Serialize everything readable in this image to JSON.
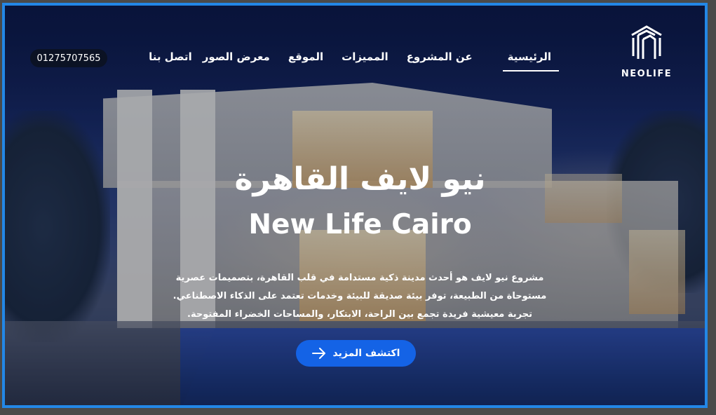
{
  "brand": {
    "name": "NEOLIFE"
  },
  "nav": {
    "items": [
      {
        "label": "الرئيسية",
        "active": true
      },
      {
        "label": "عن المشروع",
        "active": false
      },
      {
        "label": "المميزات",
        "active": false
      },
      {
        "label": "الموقع",
        "active": false
      },
      {
        "label": "معرض الصور",
        "active": false
      },
      {
        "label": "اتصل بنا",
        "active": false
      }
    ],
    "phone": "01275707565"
  },
  "hero": {
    "title_ar": "نيو لايف القاهرة",
    "title_en": "New Life Cairo",
    "description_lines": [
      "مشروع نيو لايف هو أحدث مدينة ذكية مستدامة في قلب القاهرة، بتصميمات عصرية",
      "مستوحاة من الطبيعة، توفر بيئة صديقة للبيئة وخدمات تعتمد على الذكاء الاصطناعي.",
      "تجربة معيشية فريدة تجمع بين الراحة، الابتكار، والمساحات الخضراء المفتوحة."
    ],
    "cta_label": "اكتشف المزيد",
    "cta_icon": "arrow-right-icon"
  },
  "colors": {
    "frame_border": "#2387e6",
    "cta_background": "#1463e6",
    "phone_background": "#0b1224",
    "text": "#ffffff"
  }
}
